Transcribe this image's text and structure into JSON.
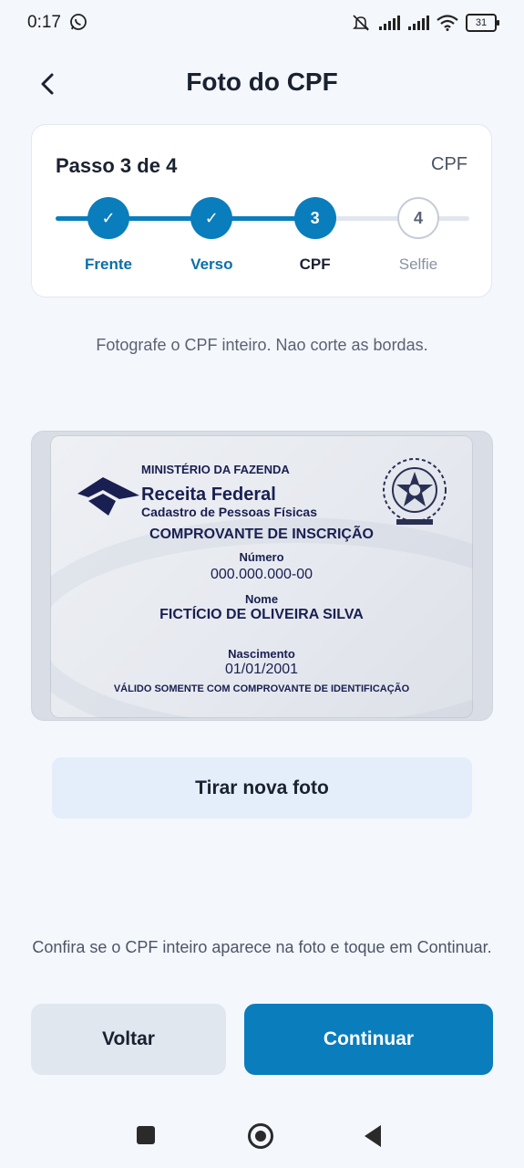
{
  "status_bar": {
    "time": "0:17",
    "battery": "31",
    "icons": [
      "whatsapp-icon",
      "mute-icon",
      "signal-icon",
      "signal-icon",
      "wifi-icon",
      "battery-icon"
    ]
  },
  "header": {
    "title": "Foto do CPF",
    "back_icon": "chevron-left-icon"
  },
  "stepper": {
    "count_text": "Passo 3 de 4",
    "current_name": "CPF",
    "progress": 0.6667,
    "steps": [
      {
        "label": "Frente",
        "state": "done",
        "marker": "✓"
      },
      {
        "label": "Verso",
        "state": "done",
        "marker": "✓"
      },
      {
        "label": "CPF",
        "state": "current",
        "marker": "3"
      },
      {
        "label": "Selfie",
        "state": "todo",
        "marker": "4"
      }
    ],
    "colors": {
      "accent": "#0a7dbd",
      "inactive": "#c6ccd6"
    }
  },
  "instruction": "Fotografe o CPF inteiro. Nao corte as bordas.",
  "cpf_card": {
    "ministry": "MINISTÉRIO DA FAZENDA",
    "agency": "Receita Federal",
    "agency_sub": "Cadastro de Pessoas Físicas",
    "doc_title": "COMPROVANTE DE INSCRIÇÃO",
    "number_label": "Número",
    "number": "000.000.000-00",
    "name_label": "Nome",
    "name": "FICTÍCIO DE OLIVEIRA SILVA",
    "birth_label": "Nascimento",
    "birth": "01/01/2001",
    "validity": "VÁLIDO SOMENTE COM COMPROVANTE DE IDENTIFICAÇÃO"
  },
  "actions": {
    "retake": "Tirar nova foto",
    "hint": "Confira se o CPF inteiro aparece na foto e toque em Continuar.",
    "back": "Voltar",
    "continue": "Continuar"
  },
  "nav_bar": {
    "icons": [
      "recents-icon",
      "home-icon",
      "back-icon"
    ]
  }
}
